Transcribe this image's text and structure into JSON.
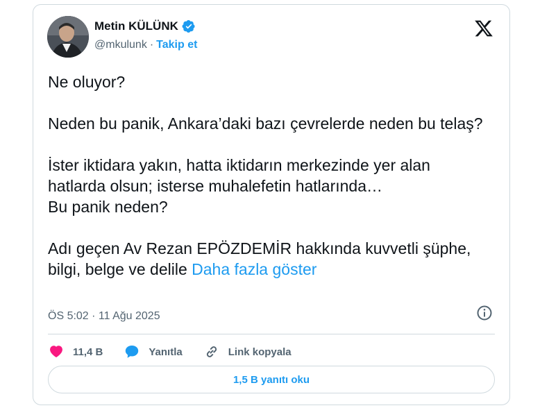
{
  "author": {
    "name": "Metin KÜLÜNK",
    "handle": "@mkulunk",
    "separator": "·",
    "follow_label": "Takip et"
  },
  "tweet": {
    "text": "Ne oluyor?\n\nNeden bu panik, Ankara’daki bazı çevrelerde neden bu telaş?\n\nİster iktidara yakın, hatta iktidarın merkezinde yer alan hatlarda olsun; isterse muhalefetin hatlarında…\nBu panik neden?\n\nAdı geçen Av Rezan EPÖZDEMİR hakkında kuvvetli şüphe, bilgi, belge ve delile ",
    "show_more": "Daha fazla göster",
    "timestamp": "ÖS 5:02 · 11 Ağu 2025"
  },
  "actions": {
    "likes": "11,4 B",
    "reply_label": "Yanıtla",
    "copy_link_label": "Link kopyala"
  },
  "read_replies_label": "1,5 B yanıtı oku",
  "icons": {
    "verified": "verified-badge-icon",
    "logo": "x-logo-icon",
    "info": "info-icon",
    "like": "heart-icon",
    "reply": "speech-bubble-icon",
    "link": "link-icon"
  },
  "colors": {
    "accent": "#1d9bf0",
    "like": "#f91880",
    "text": "#0f1419",
    "muted": "#536471",
    "border": "#cfd9de"
  }
}
